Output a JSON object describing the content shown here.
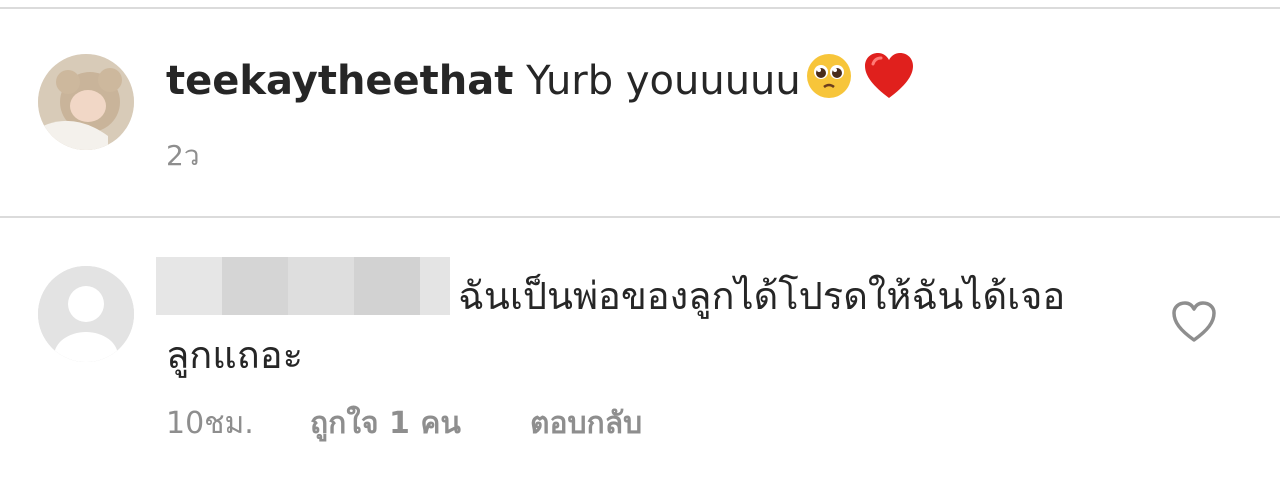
{
  "comments": [
    {
      "username": "teekaytheethat",
      "text": "Yurb youuuuu",
      "time": "2ว"
    },
    {
      "text_line1": "ฉันเป็นพ่อของลูกได้โปรดให้ฉันได้เจอ",
      "text_line2": "ลูกแถอะ",
      "time": "10ชม.",
      "likes_label": "ถูกใจ 1 คน",
      "reply_label": "ตอบกลับ"
    }
  ],
  "icons": {
    "pleading_emoji": "pleading-face-emoji",
    "red_heart_emoji": "red-heart-emoji",
    "like": "heart-outline-icon"
  },
  "colors": {
    "text": "#262626",
    "secondary": "#8e8e8e",
    "divider": "#dbdbdb",
    "heart_red": "#e0201d",
    "redaction": "#d9d9d9"
  }
}
